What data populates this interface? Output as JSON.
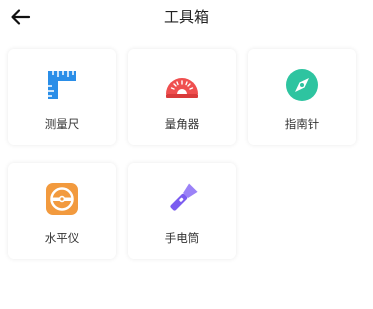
{
  "header": {
    "title": "工具箱",
    "back_icon": "back-arrow-icon"
  },
  "tools": [
    {
      "label": "测量尺",
      "icon": "ruler-icon",
      "color": "#2a8ee8"
    },
    {
      "label": "量角器",
      "icon": "protractor-icon",
      "color": "#ef4f4f"
    },
    {
      "label": "指南针",
      "icon": "compass-icon",
      "color": "#2ec4a0"
    },
    {
      "label": "水平仪",
      "icon": "level-icon",
      "color": "#f29a3e"
    },
    {
      "label": "手电筒",
      "icon": "flashlight-icon",
      "color": "#7b5cf0"
    }
  ]
}
